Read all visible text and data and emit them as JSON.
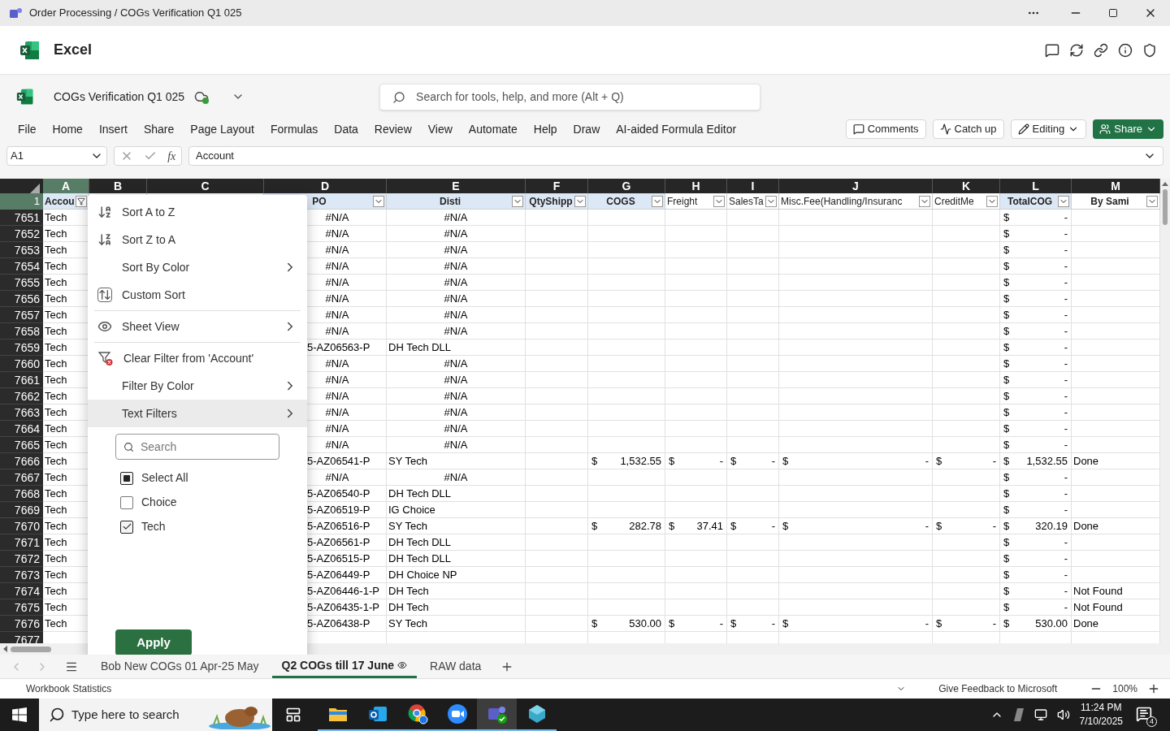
{
  "window": {
    "title": "Order Processing / COGs Verification Q1 025"
  },
  "app": {
    "name": "Excel"
  },
  "file": {
    "name": "COGs Verification Q1 025"
  },
  "search": {
    "placeholder": "Search for tools, help, and more (Alt + Q)"
  },
  "ribbon_tabs": [
    "File",
    "Home",
    "Insert",
    "Share",
    "Page Layout",
    "Formulas",
    "Data",
    "Review",
    "View",
    "Automate",
    "Help",
    "Draw",
    "AI-aided Formula Editor"
  ],
  "actions": [
    {
      "label": "Comments",
      "kind": "plain"
    },
    {
      "label": "Catch up",
      "kind": "plain"
    },
    {
      "label": "Editing",
      "kind": "dropdown"
    },
    {
      "label": "Share",
      "kind": "primary"
    }
  ],
  "formula_bar": {
    "name_box": "A1",
    "fx": "fx",
    "value": "Account"
  },
  "columns": [
    {
      "letter": "A",
      "selected": true
    },
    {
      "letter": "B",
      "selected": false
    },
    {
      "letter": "C",
      "selected": false
    },
    {
      "letter": "D",
      "selected": false
    },
    {
      "letter": "E",
      "selected": false
    },
    {
      "letter": "F",
      "selected": false
    },
    {
      "letter": "G",
      "selected": false
    },
    {
      "letter": "H",
      "selected": false
    },
    {
      "letter": "I",
      "selected": false
    },
    {
      "letter": "J",
      "selected": false
    },
    {
      "letter": "K",
      "selected": false
    },
    {
      "letter": "L",
      "selected": false
    },
    {
      "letter": "M",
      "selected": false
    }
  ],
  "header_row": "1",
  "headers": [
    {
      "text": "Accou",
      "bold": true,
      "shaded": true,
      "filtered": true
    },
    {
      "text": "PO",
      "bold": true,
      "shaded": true,
      "filtered": false
    },
    {
      "text": "Disti",
      "bold": true,
      "shaded": true,
      "filtered": false
    },
    {
      "text": "QtyShipp",
      "bold": true,
      "shaded": true,
      "filtered": false
    },
    {
      "text": "COGS",
      "bold": true,
      "shaded": true,
      "filtered": false
    },
    {
      "text": "Freight",
      "bold": false,
      "shaded": false,
      "filtered": false
    },
    {
      "text": "SalesTa",
      "bold": false,
      "shaded": false,
      "filtered": false
    },
    {
      "text": "Misc.Fee(Handling/Insuranc",
      "bold": false,
      "shaded": false,
      "filtered": false
    },
    {
      "text": "CreditMe",
      "bold": false,
      "shaded": false,
      "filtered": false
    },
    {
      "text": "TotalCOG",
      "bold": true,
      "shaded": true,
      "filtered": false
    },
    {
      "text": "By Sami",
      "bold": true,
      "shaded": false,
      "filtered": false
    }
  ],
  "rows": [
    {
      "number": "7651",
      "account": "Tech",
      "kind": "unmatched",
      "po": "#N/A",
      "disti": "#N/A",
      "total": [
        "$",
        "-"
      ]
    },
    {
      "number": "7652",
      "account": "Tech",
      "kind": "unmatched",
      "po": "#N/A",
      "disti": "#N/A",
      "total": [
        "$",
        "-"
      ]
    },
    {
      "number": "7653",
      "account": "Tech",
      "kind": "unmatched",
      "po": "#N/A",
      "disti": "#N/A",
      "total": [
        "$",
        "-"
      ]
    },
    {
      "number": "7654",
      "account": "Tech",
      "kind": "unmatched",
      "po": "#N/A",
      "disti": "#N/A",
      "total": [
        "$",
        "-"
      ]
    },
    {
      "number": "7655",
      "account": "Tech",
      "kind": "unmatched",
      "po": "#N/A",
      "disti": "#N/A",
      "total": [
        "$",
        "-"
      ]
    },
    {
      "number": "7656",
      "account": "Tech",
      "kind": "unmatched",
      "po": "#N/A",
      "disti": "#N/A",
      "total": [
        "$",
        "-"
      ]
    },
    {
      "number": "7657",
      "account": "Tech",
      "kind": "unmatched",
      "po": "#N/A",
      "disti": "#N/A",
      "total": [
        "$",
        "-"
      ]
    },
    {
      "number": "7658",
      "account": "Tech",
      "kind": "unmatched",
      "po": "#N/A",
      "disti": "#N/A",
      "total": [
        "$",
        "-"
      ]
    },
    {
      "number": "7659",
      "account": "Tech",
      "kind": "matched",
      "po": "5-AZ06563-P",
      "disti": "DH Tech DLL",
      "total": [
        "$",
        "-"
      ]
    },
    {
      "number": "7660",
      "account": "Tech",
      "kind": "unmatched",
      "po": "#N/A",
      "disti": "#N/A",
      "total": [
        "$",
        "-"
      ]
    },
    {
      "number": "7661",
      "account": "Tech",
      "kind": "unmatched",
      "po": "#N/A",
      "disti": "#N/A",
      "total": [
        "$",
        "-"
      ]
    },
    {
      "number": "7662",
      "account": "Tech",
      "kind": "unmatched",
      "po": "#N/A",
      "disti": "#N/A",
      "total": [
        "$",
        "-"
      ]
    },
    {
      "number": "7663",
      "account": "Tech",
      "kind": "unmatched",
      "po": "#N/A",
      "disti": "#N/A",
      "total": [
        "$",
        "-"
      ]
    },
    {
      "number": "7664",
      "account": "Tech",
      "kind": "unmatched",
      "po": "#N/A",
      "disti": "#N/A",
      "total": [
        "$",
        "-"
      ]
    },
    {
      "number": "7665",
      "account": "Tech",
      "kind": "unmatched",
      "po": "#N/A",
      "disti": "#N/A",
      "total": [
        "$",
        "-"
      ]
    },
    {
      "number": "7666",
      "account": "Tech",
      "kind": "matched",
      "po": "5-AZ06541-P",
      "disti": "SY Tech",
      "cogs": [
        "$",
        "1,532.55"
      ],
      "freight": [
        "$",
        "-"
      ],
      "sales_tax": [
        "$",
        "-"
      ],
      "misc_fee": [
        "$",
        "-"
      ],
      "credit_memo": [
        "$",
        "-"
      ],
      "total": [
        "$",
        "1,532.55"
      ],
      "by_sami": "Done"
    },
    {
      "number": "7667",
      "account": "Tech",
      "kind": "unmatched",
      "po": "#N/A",
      "disti": "#N/A",
      "total": [
        "$",
        "-"
      ]
    },
    {
      "number": "7668",
      "account": "Tech",
      "kind": "matched",
      "po": "5-AZ06540-P",
      "disti": "DH Tech DLL",
      "total": [
        "$",
        "-"
      ]
    },
    {
      "number": "7669",
      "account": "Tech",
      "kind": "matched",
      "po": "5-AZ06519-P",
      "disti": "IG Choice",
      "total": [
        "$",
        "-"
      ]
    },
    {
      "number": "7670",
      "account": "Tech",
      "kind": "matched",
      "po": "5-AZ06516-P",
      "disti": "SY Tech",
      "cogs": [
        "$",
        "282.78"
      ],
      "freight": [
        "$",
        "37.41"
      ],
      "sales_tax": [
        "$",
        "-"
      ],
      "misc_fee": [
        "$",
        "-"
      ],
      "credit_memo": [
        "$",
        "-"
      ],
      "total": [
        "$",
        "320.19"
      ],
      "by_sami": "Done"
    },
    {
      "number": "7671",
      "account": "Tech",
      "kind": "matched",
      "po": "5-AZ06561-P",
      "disti": "DH Tech DLL",
      "total": [
        "$",
        "-"
      ]
    },
    {
      "number": "7672",
      "account": "Tech",
      "kind": "matched",
      "po": "5-AZ06515-P",
      "disti": "DH Tech DLL",
      "total": [
        "$",
        "-"
      ]
    },
    {
      "number": "7673",
      "account": "Tech",
      "kind": "matched",
      "po": "5-AZ06449-P",
      "disti": "DH Choice NP",
      "total": [
        "$",
        "-"
      ]
    },
    {
      "number": "7674",
      "account": "Tech",
      "kind": "matched",
      "po": "5-AZ06446-1-P",
      "disti": "DH Tech",
      "total": [
        "$",
        "-"
      ],
      "by_sami": "Not Found"
    },
    {
      "number": "7675",
      "account": "Tech",
      "kind": "matched",
      "po": "5-AZ06435-1-P",
      "disti": "DH Tech",
      "total": [
        "$",
        "-"
      ],
      "by_sami": "Not Found"
    },
    {
      "number": "7676",
      "account": "Tech",
      "kind": "matched",
      "po": "5-AZ06438-P",
      "disti": "SY Tech",
      "cogs": [
        "$",
        "530.00"
      ],
      "freight": [
        "$",
        "-"
      ],
      "sales_tax": [
        "$",
        "-"
      ],
      "misc_fee": [
        "$",
        "-"
      ],
      "credit_memo": [
        "$",
        "-"
      ],
      "total": [
        "$",
        "530.00"
      ],
      "by_sami": "Done"
    },
    {
      "number": "7677",
      "kind": "empty"
    }
  ],
  "filter_menu": {
    "items": [
      {
        "label": "Sort A to Z",
        "submenu": false,
        "selected": false,
        "separated": false
      },
      {
        "label": "Sort Z to A",
        "submenu": false,
        "selected": false,
        "separated": false
      },
      {
        "label": "Sort By Color",
        "submenu": true,
        "selected": false,
        "separated": false
      },
      {
        "label": "Custom Sort",
        "submenu": false,
        "selected": false,
        "separated": false
      },
      {
        "label": "Sheet View",
        "submenu": true,
        "selected": false,
        "separated": true
      },
      {
        "label": "Clear Filter from 'Account'",
        "submenu": false,
        "selected": false,
        "separated": true
      },
      {
        "label": "Filter By Color",
        "submenu": true,
        "selected": false,
        "separated": false
      },
      {
        "label": "Text Filters",
        "submenu": true,
        "selected": true,
        "separated": false
      }
    ],
    "search_placeholder": "Search",
    "values": [
      {
        "label": "Select All",
        "checked": true,
        "indeterminate": true
      },
      {
        "label": "Choice",
        "checked": false
      },
      {
        "label": "Tech",
        "checked": true
      }
    ],
    "apply": "Apply"
  },
  "sheet_tabs": [
    {
      "label": "Bob New COGs 01 Apr-25 May",
      "selected": false
    },
    {
      "label": "Q2 COGs till 17 June",
      "selected": true
    },
    {
      "label": "RAW data",
      "selected": false
    }
  ],
  "status_bar": {
    "left": "Workbook Statistics",
    "feedback": "Give Feedback to Microsoft",
    "zoom": "100%"
  },
  "taskbar": {
    "search_placeholder": "Type here to search",
    "apps": [
      {
        "selected": false
      },
      {
        "selected": false
      },
      {
        "selected": false
      },
      {
        "selected": false
      },
      {
        "selected": true
      },
      {
        "selected": false
      }
    ],
    "time": "11:24 PM",
    "date": "7/10/2025",
    "notifications": "4"
  }
}
